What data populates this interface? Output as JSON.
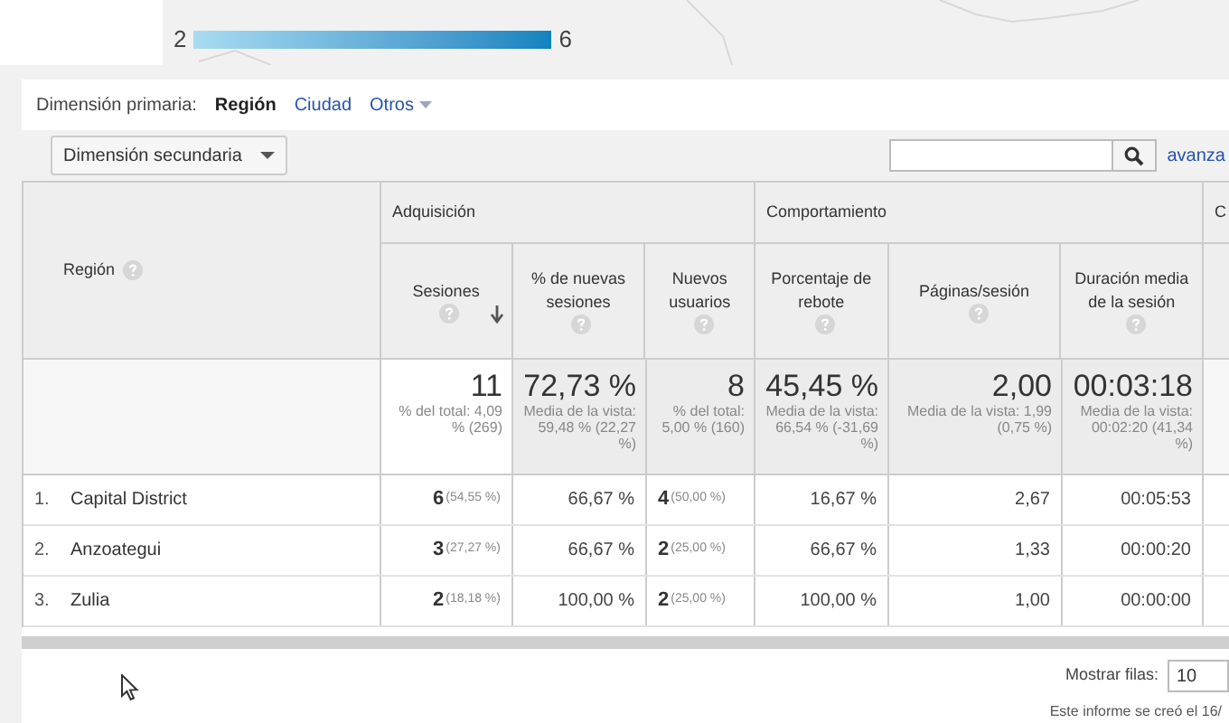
{
  "map_legend": {
    "min": "2",
    "max": "6"
  },
  "primary_dimension": {
    "label": "Dimensión primaria:",
    "options": [
      {
        "label": "Región",
        "selected": true,
        "kind": "link"
      },
      {
        "label": "Ciudad",
        "selected": false,
        "kind": "link"
      },
      {
        "label": "Otros",
        "selected": false,
        "kind": "dropdown"
      }
    ]
  },
  "secondary_dimension": {
    "label": "Dimensión secundaria"
  },
  "advanced_link": "avanza",
  "table": {
    "region_header": "Región",
    "groups": [
      {
        "label": "Adquisición",
        "columns": [
          {
            "label": "Sesiones",
            "sorted": true
          },
          {
            "label": "% de nuevas sesiones",
            "sorted": false
          },
          {
            "label": "Nuevos usuarios",
            "sorted": false
          }
        ]
      },
      {
        "label": "Comportamiento",
        "columns": [
          {
            "label": "Porcentaje de rebote",
            "sorted": false
          },
          {
            "label": "Páginas/sesión",
            "sorted": false
          },
          {
            "label": "Duración media de la sesión",
            "sorted": false
          }
        ]
      },
      {
        "label": "C"
      }
    ],
    "totals": [
      {
        "value": "11",
        "note": "% del total: 4,09 % (269)"
      },
      {
        "value": "72,73 %",
        "note": "Media de la vista: 59,48 % (22,27 %)"
      },
      {
        "value": "8",
        "note": "% del total: 5,00 % (160)"
      },
      {
        "value": "45,45 %",
        "note": "Media de la vista: 66,54 % (-31,69 %)"
      },
      {
        "value": "2,00",
        "note": "Media de la vista: 1,99 (0,75 %)"
      },
      {
        "value": "00:03:18",
        "note": "Media de la vista: 00:02:20 (41,34 %)"
      }
    ],
    "rows": [
      {
        "index": "1.",
        "region": "Capital District",
        "cells": [
          {
            "value": "6",
            "share": "(54,55 %)"
          },
          {
            "value": "66,67 %"
          },
          {
            "value": "4",
            "share": "(50,00 %)"
          },
          {
            "value": "16,67 %"
          },
          {
            "value": "2,67"
          },
          {
            "value": "00:05:53"
          }
        ]
      },
      {
        "index": "2.",
        "region": "Anzoategui",
        "cells": [
          {
            "value": "3",
            "share": "(27,27 %)"
          },
          {
            "value": "66,67 %"
          },
          {
            "value": "2",
            "share": "(25,00 %)"
          },
          {
            "value": "66,67 %"
          },
          {
            "value": "1,33"
          },
          {
            "value": "00:00:20"
          }
        ]
      },
      {
        "index": "3.",
        "region": "Zulia",
        "cells": [
          {
            "value": "2",
            "share": "(18,18 %)"
          },
          {
            "value": "100,00 %"
          },
          {
            "value": "2",
            "share": "(25,00 %)"
          },
          {
            "value": "100,00 %"
          },
          {
            "value": "1,00"
          },
          {
            "value": "00:00:00"
          }
        ]
      }
    ]
  },
  "footer": {
    "rows_label": "Mostrar filas:",
    "rows_value": "10",
    "note": "Este informe se creó el 16/"
  }
}
